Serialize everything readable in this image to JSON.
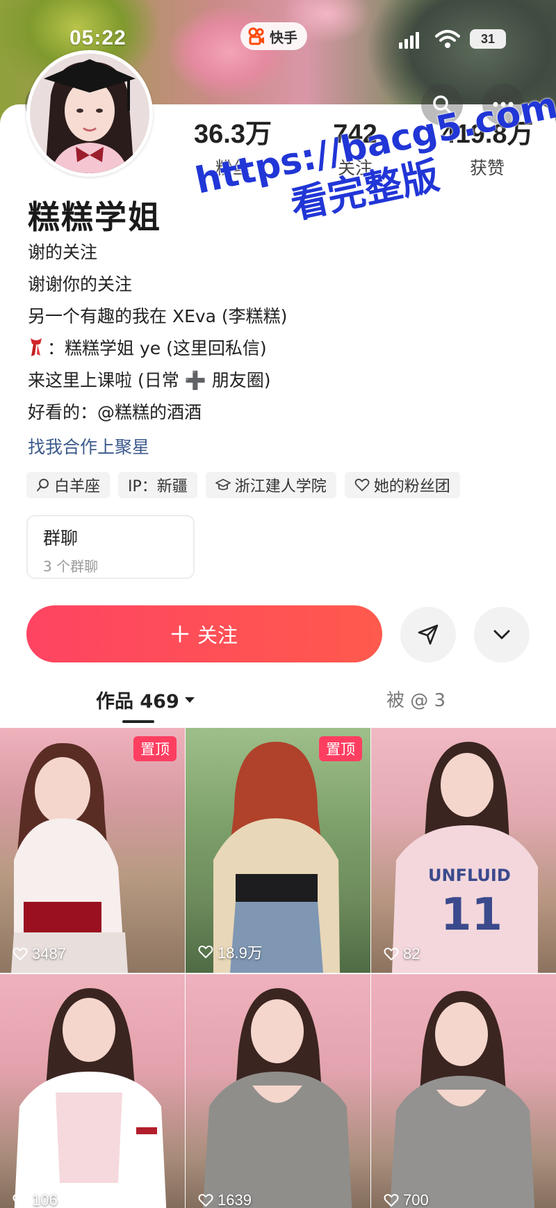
{
  "status_bar": {
    "time": "05:22",
    "app_name": "快手",
    "battery": "31"
  },
  "profile": {
    "nickname": "糕糕学姐",
    "stats": [
      {
        "value": "36.3万",
        "label": "粉丝"
      },
      {
        "value": "742",
        "label": "关注"
      },
      {
        "value": "419.8万",
        "label": "获赞"
      }
    ],
    "bio": [
      "谢的关注",
      "谢谢你的关注",
      "另一个有趣的我在 XEva (李糕糕)",
      "：糕糕学姐 ye (这里回私信)",
      "来这里上课啦 (日常 ➕ 朋友圈)",
      "好看的：@糕糕的酒酒"
    ],
    "bio_emoji": "scarf-emoji",
    "cooperation_link": "找我合作上聚星",
    "tags": [
      {
        "icon": "search-icon",
        "label": "白羊座"
      },
      {
        "icon": "",
        "label": "IP：新疆"
      },
      {
        "icon": "graduation-cap-icon",
        "label": "浙江建人学院"
      },
      {
        "icon": "heart-icon",
        "label": "她的粉丝团"
      }
    ],
    "group_chat": {
      "title": "群聊",
      "subtitle": "3 个群聊"
    }
  },
  "actions": {
    "follow_label": "关注",
    "follow_icon": "plus-icon",
    "share_icon": "send-icon",
    "more_icon": "chevron-down-icon"
  },
  "tabs": {
    "works_label": "作品 469",
    "mentioned_label": "被 @ 3"
  },
  "grid": {
    "pinned_label": "置顶",
    "items": [
      {
        "likes": "3487",
        "pinned": true
      },
      {
        "likes": "18.9万",
        "pinned": true
      },
      {
        "likes": "82",
        "pinned": false
      },
      {
        "likes": "106",
        "pinned": false
      },
      {
        "likes": "1639",
        "pinned": false
      },
      {
        "likes": "700",
        "pinned": false
      }
    ]
  },
  "watermark": {
    "url": "https://bacg5.com",
    "note": "看完整版"
  },
  "colors": {
    "accent": "#fe4462",
    "link": "#3c5a8c",
    "watermark": "#2136d6"
  }
}
